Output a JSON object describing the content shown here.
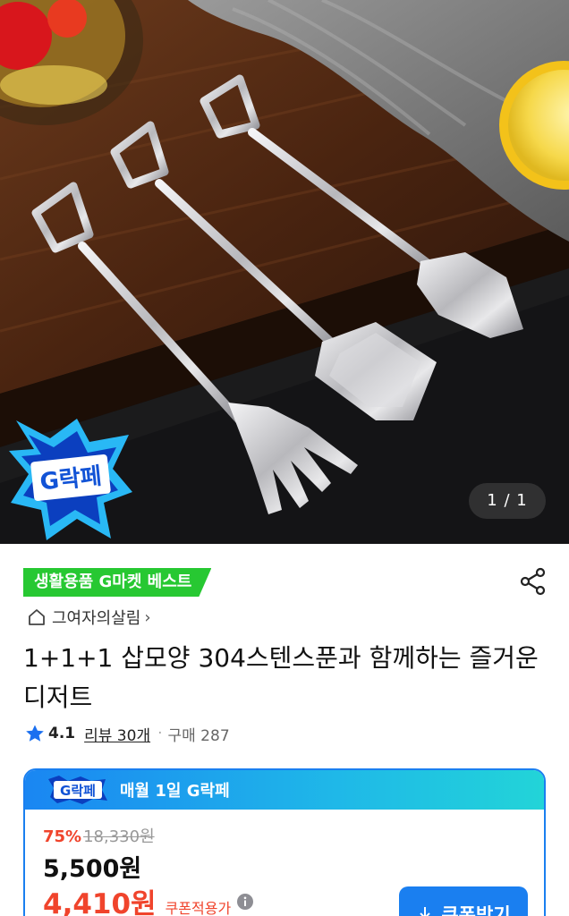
{
  "gallery": {
    "page_indicator": "1 / 1",
    "badge_text": "G락페"
  },
  "product": {
    "best_tag": "생활용품 G마켓 베스트",
    "shop_name": "그여자의살림",
    "shop_chevron": "›",
    "title": "1+1+1 삽모양 304스텐스푼과 함께하는 즐거운 디저트",
    "rating": "4.1",
    "review_label": "리뷰 30개",
    "dot": "·",
    "sales_label": "구매 287"
  },
  "coupon": {
    "logo_text": "G락페",
    "event_label": "매월 1일 G락페",
    "discount_pct": "75%",
    "original_price": "18,330원",
    "price": "5,500원",
    "coupon_price": "4,410원",
    "coupon_price_note": "쿠폰적용가",
    "button_label": "쿠폰받기"
  },
  "colors": {
    "accent_blue": "#1a7ff0",
    "best_green": "#27c832",
    "sale_red": "#f0442c"
  },
  "icons": [
    "share-icon",
    "home-icon",
    "star-icon",
    "info-icon",
    "download-icon"
  ]
}
